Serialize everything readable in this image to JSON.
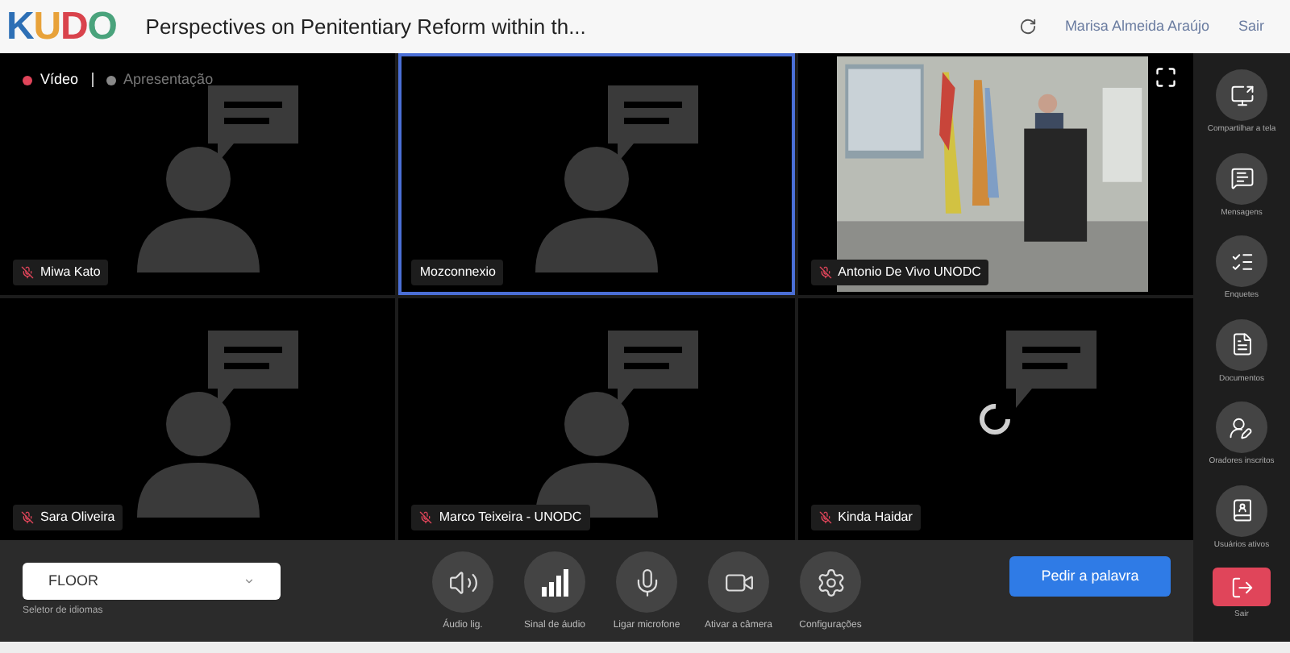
{
  "header": {
    "logo": "KUDO",
    "title": "Perspectives on Penitentiary Reform within th...",
    "user": "Marisa Almeida Araújo",
    "signout": "Sair"
  },
  "view_toggle": [
    {
      "label": "Vídeo",
      "selected": true
    },
    {
      "label": "Apresentação",
      "selected": false
    }
  ],
  "tiles": [
    {
      "name": "Miwa Kato",
      "kind": "avatar",
      "muted": true,
      "selected": false
    },
    {
      "name": "Mozconnexio",
      "kind": "avatar",
      "muted": false,
      "selected": true
    },
    {
      "name": "Antonio De Vivo UNODC",
      "kind": "video",
      "muted": true,
      "selected": false
    },
    {
      "name": "Sara Oliveira",
      "kind": "avatar",
      "muted": true,
      "selected": false
    },
    {
      "name": "Marco Teixeira - UNODC",
      "kind": "avatar",
      "muted": true,
      "selected": false
    },
    {
      "name": "Kinda Haidar",
      "kind": "loading",
      "muted": true,
      "selected": false
    }
  ],
  "sidebar": [
    {
      "label": "Compartilhar a tela",
      "kind": "share"
    },
    {
      "label": "Mensagens",
      "kind": "messages"
    },
    {
      "label": "Enquetes",
      "kind": "polls"
    },
    {
      "label": "Documentos",
      "kind": "documents"
    },
    {
      "label": "Oradores inscritos",
      "kind": "speakers"
    },
    {
      "label": "Usuários ativos",
      "kind": "users"
    },
    {
      "label": "Sair",
      "kind": "exit"
    }
  ],
  "language": {
    "value": "FLOOR",
    "caption": "Seletor de idiomas"
  },
  "controls": [
    {
      "label": "Áudio lig.",
      "kind": "speaker"
    },
    {
      "label": "Sinal de áudio",
      "kind": "signal"
    },
    {
      "label": "Ligar microfone",
      "kind": "mic"
    },
    {
      "label": "Ativar a câmera",
      "kind": "camera"
    },
    {
      "label": "Configurações",
      "kind": "settings"
    }
  ],
  "request_button": "Pedir a palavra"
}
